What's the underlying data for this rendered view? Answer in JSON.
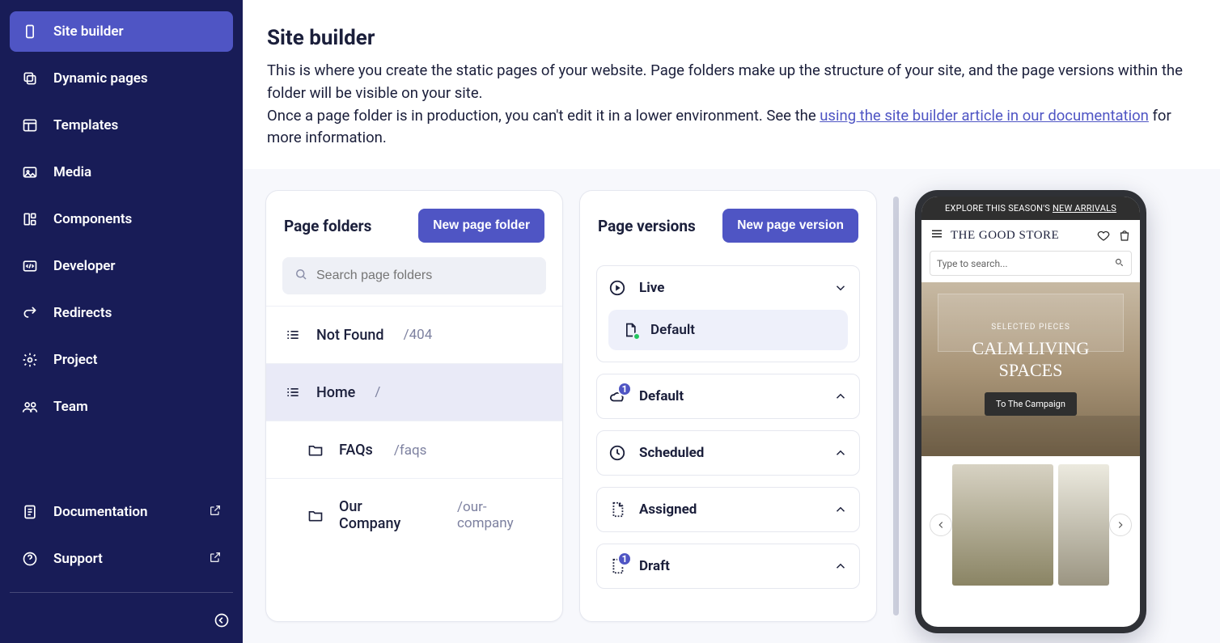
{
  "sidebar": {
    "items": [
      {
        "id": "site-builder",
        "label": "Site builder"
      },
      {
        "id": "dynamic-pages",
        "label": "Dynamic pages"
      },
      {
        "id": "templates",
        "label": "Templates"
      },
      {
        "id": "media",
        "label": "Media"
      },
      {
        "id": "components",
        "label": "Components"
      },
      {
        "id": "developer",
        "label": "Developer"
      },
      {
        "id": "redirects",
        "label": "Redirects"
      },
      {
        "id": "project",
        "label": "Project"
      },
      {
        "id": "team",
        "label": "Team"
      }
    ],
    "docs": {
      "label": "Documentation"
    },
    "support": {
      "label": "Support"
    }
  },
  "header": {
    "title": "Site builder",
    "p1": "This is where you create the static pages of your website. Page folders make up the structure of your site, and the page versions within the folder will be visible on your site.",
    "p2a": "Once a page folder is in production, you can't edit it in a lower environment. See the ",
    "link": "using the site builder article in our documentation",
    "p2b": " for more information."
  },
  "folders": {
    "title": "Page folders",
    "new_btn": "New page folder",
    "search_placeholder": "Search page folders",
    "items": [
      {
        "name": "Not Found",
        "path": "/404",
        "depth": 0
      },
      {
        "name": "Home",
        "path": "/",
        "depth": 0,
        "selected": true
      },
      {
        "name": "FAQs",
        "path": "/faqs",
        "depth": 1
      },
      {
        "name": "Our Company",
        "path": "/our-company",
        "depth": 1
      }
    ]
  },
  "versions": {
    "title": "Page versions",
    "new_btn": "New page version",
    "live": {
      "label": "Live",
      "default_label": "Default"
    },
    "default": {
      "label": "Default",
      "badge": "1"
    },
    "scheduled": {
      "label": "Scheduled"
    },
    "assigned": {
      "label": "Assigned"
    },
    "draft": {
      "label": "Draft",
      "badge": "1"
    }
  },
  "preview": {
    "topbar_a": "EXPLORE THIS SEASON'S ",
    "topbar_b": "NEW ARRIVALS",
    "store": "THE GOOD STORE",
    "search_placeholder": "Type to search...",
    "hero_sub": "SELECTED PIECES",
    "hero_title_a": "CALM LIVING",
    "hero_title_b": "SPACES",
    "hero_cta": "To The Campaign"
  }
}
